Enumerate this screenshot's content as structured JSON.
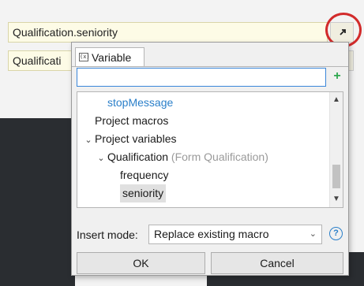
{
  "background": {
    "field1_value": "Qualification.seniority",
    "field2_value": "Qualificati"
  },
  "popup": {
    "tab_label": "Variable",
    "tab_icon_text": "(x)",
    "search_value": "",
    "add_symbol": "+",
    "tree": [
      {
        "label": "stopMessage",
        "indent": 2,
        "chevron": "",
        "hint": "",
        "link": true,
        "selected": false
      },
      {
        "label": "Project macros",
        "indent": 1,
        "chevron": "",
        "hint": "",
        "link": false,
        "selected": false
      },
      {
        "label": "Project variables",
        "indent": 0,
        "chevron": "⌄",
        "hint": "",
        "link": false,
        "selected": false
      },
      {
        "label": "Qualification",
        "indent": 1,
        "chevron": "⌄",
        "hint": " (Form Qualification)",
        "link": false,
        "selected": false
      },
      {
        "label": "frequency",
        "indent": 3,
        "chevron": "",
        "hint": "",
        "link": false,
        "selected": false
      },
      {
        "label": "seniority",
        "indent": 3,
        "chevron": "",
        "hint": "",
        "link": false,
        "selected": true
      }
    ],
    "insert_mode_label": "Insert mode:",
    "insert_mode_value": "Replace existing macro",
    "help_symbol": "?",
    "ok_label": "OK",
    "cancel_label": "Cancel"
  },
  "colors": {
    "highlight_circle": "#d22b2b",
    "link_blue": "#2a7fc9",
    "add_green": "#2fa84f",
    "search_border": "#3a86d9"
  }
}
